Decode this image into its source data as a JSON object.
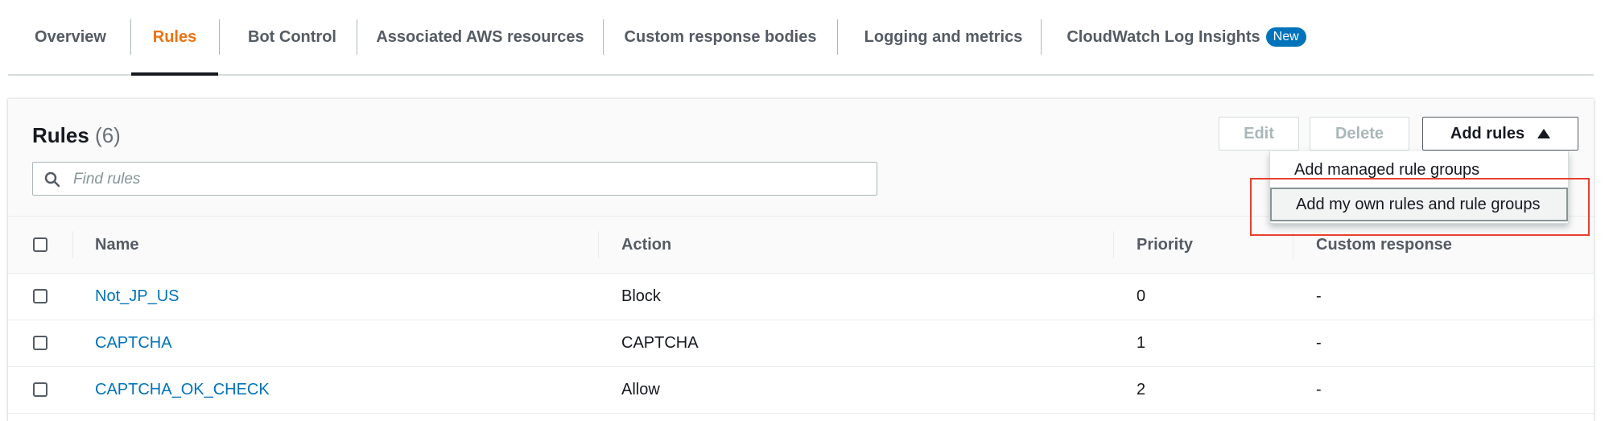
{
  "tabs": [
    {
      "label": "Overview",
      "active": false
    },
    {
      "label": "Rules",
      "active": true
    },
    {
      "label": "Bot Control",
      "active": false
    },
    {
      "label": "Associated AWS resources",
      "active": false
    },
    {
      "label": "Custom response bodies",
      "active": false
    },
    {
      "label": "Logging and metrics",
      "active": false
    },
    {
      "label": "CloudWatch Log Insights",
      "active": false,
      "badge": "New"
    }
  ],
  "rules": {
    "title": "Rules",
    "count": "(6)",
    "edit_label": "Edit",
    "delete_label": "Delete",
    "add_rules_label": "Add rules",
    "search_placeholder": "Find rules",
    "search_value": ""
  },
  "dropdown": {
    "items": [
      {
        "label": "Add managed rule groups"
      },
      {
        "label": "Add my own rules and rule groups",
        "hovered": true
      }
    ]
  },
  "table": {
    "columns": [
      "Name",
      "Action",
      "Priority",
      "Custom response"
    ],
    "rows": [
      {
        "name": "Not_JP_US",
        "action": "Block",
        "priority": "0",
        "custom_response": "-"
      },
      {
        "name": "CAPTCHA",
        "action": "CAPTCHA",
        "priority": "1",
        "custom_response": "-"
      },
      {
        "name": "CAPTCHA_OK_CHECK",
        "action": "Allow",
        "priority": "2",
        "custom_response": "-"
      }
    ]
  },
  "colors": {
    "active_tab": "#ec7211",
    "link": "#0073bb",
    "badge": "#0073bb",
    "highlight_box": "#e8402e"
  },
  "icons": {
    "search": "search-icon",
    "add_rules_caret": "caret-up-icon"
  }
}
